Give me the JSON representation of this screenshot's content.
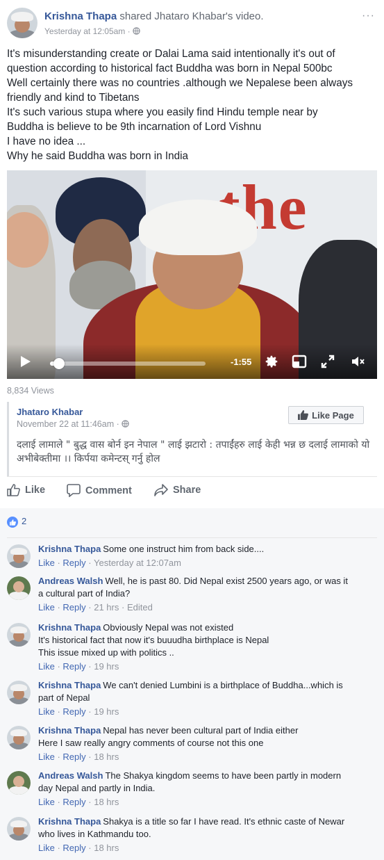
{
  "post": {
    "author": "Krishna Thapa",
    "shared_text": "shared Jhataro Khabar's video.",
    "time": "Yesterday at 12:05am · ",
    "menu": "···",
    "text_lines": [
      "It's misunderstanding create or Dalai Lama said intentionally it's out of",
      "question according to historical fact Buddha was born in Nepal 500bc",
      "Well certainly there was no countries .although we Nepalese been always",
      "friendly and kind to Tibetans",
      "It's such various stupa where you easily find Hindu temple near by",
      "Buddha is believe to be 9th incarnation of Lord Vishnu",
      "I have no idea ...",
      "Why he said Buddha was born in India"
    ]
  },
  "video": {
    "bg_text": "the",
    "time_left": "-1:55",
    "progress": 0.06,
    "views": "8,834 Views"
  },
  "shared_page": {
    "name": "Jhataro Khabar",
    "time": "November 22 at 11:46am · ",
    "like_page_label": "Like Page",
    "text_lines": [
      "दलाई लामाले \" बुद्ध वास बोर्न इन नेपाल \" लाई झटारो : तपाईंहरु लाई केही भन्न छ दलाई लामाको यो",
      "अभीबेक्तीमा ।। किर्पया कमेन्टस् गर्नु होल"
    ]
  },
  "actions": {
    "like": "Like",
    "comment": "Comment",
    "share": "Share"
  },
  "reactions": {
    "count": "2"
  },
  "comments": [
    {
      "author": "Krishna Thapa",
      "avatar": "kt",
      "text": [
        "Some one instruct him from back side...."
      ],
      "like": "Like",
      "reply": "Reply",
      "time": "Yesterday at 12:07am",
      "edited": ""
    },
    {
      "author": "Andreas Walsh",
      "avatar": "aw",
      "text": [
        "Well, he is past 80. Did Nepal exist 2500 years ago, or was it",
        "a cultural part of India?"
      ],
      "like": "Like",
      "reply": "Reply",
      "time": "21 hrs",
      "edited": "Edited"
    },
    {
      "author": "Krishna Thapa",
      "avatar": "kt",
      "text": [
        "Obviously Nepal was not existed",
        "It's historical fact that now it's buuudha birthplace is Nepal",
        "This issue mixed up with politics .."
      ],
      "like": "Like",
      "reply": "Reply",
      "time": "19 hrs",
      "edited": ""
    },
    {
      "author": "Krishna Thapa",
      "avatar": "kt",
      "text": [
        "We can't denied Lumbini is a birthplace of Buddha...which is",
        "part of Nepal"
      ],
      "like": "Like",
      "reply": "Reply",
      "time": "19 hrs",
      "edited": ""
    },
    {
      "author": "Krishna Thapa",
      "avatar": "kt",
      "text": [
        "Nepal has never been cultural part of India either",
        "Here I saw really angry comments of course not this one"
      ],
      "like": "Like",
      "reply": "Reply",
      "time": "18 hrs",
      "edited": ""
    },
    {
      "author": "Andreas Walsh",
      "avatar": "aw",
      "text": [
        "The Shakya kingdom seems to have been partly in modern",
        "day Nepal and partly in India."
      ],
      "like": "Like",
      "reply": "Reply",
      "time": "18 hrs",
      "edited": ""
    },
    {
      "author": "Krishna Thapa",
      "avatar": "kt",
      "text": [
        "Shakya is a title so far I have read. It's ethnic caste of Newar",
        "who lives in Kathmandu too."
      ],
      "like": "Like",
      "reply": "Reply",
      "time": "18 hrs",
      "edited": ""
    }
  ],
  "colors": {
    "link": "#365899",
    "muted": "#90949c",
    "like_blue": "#5890ff"
  }
}
